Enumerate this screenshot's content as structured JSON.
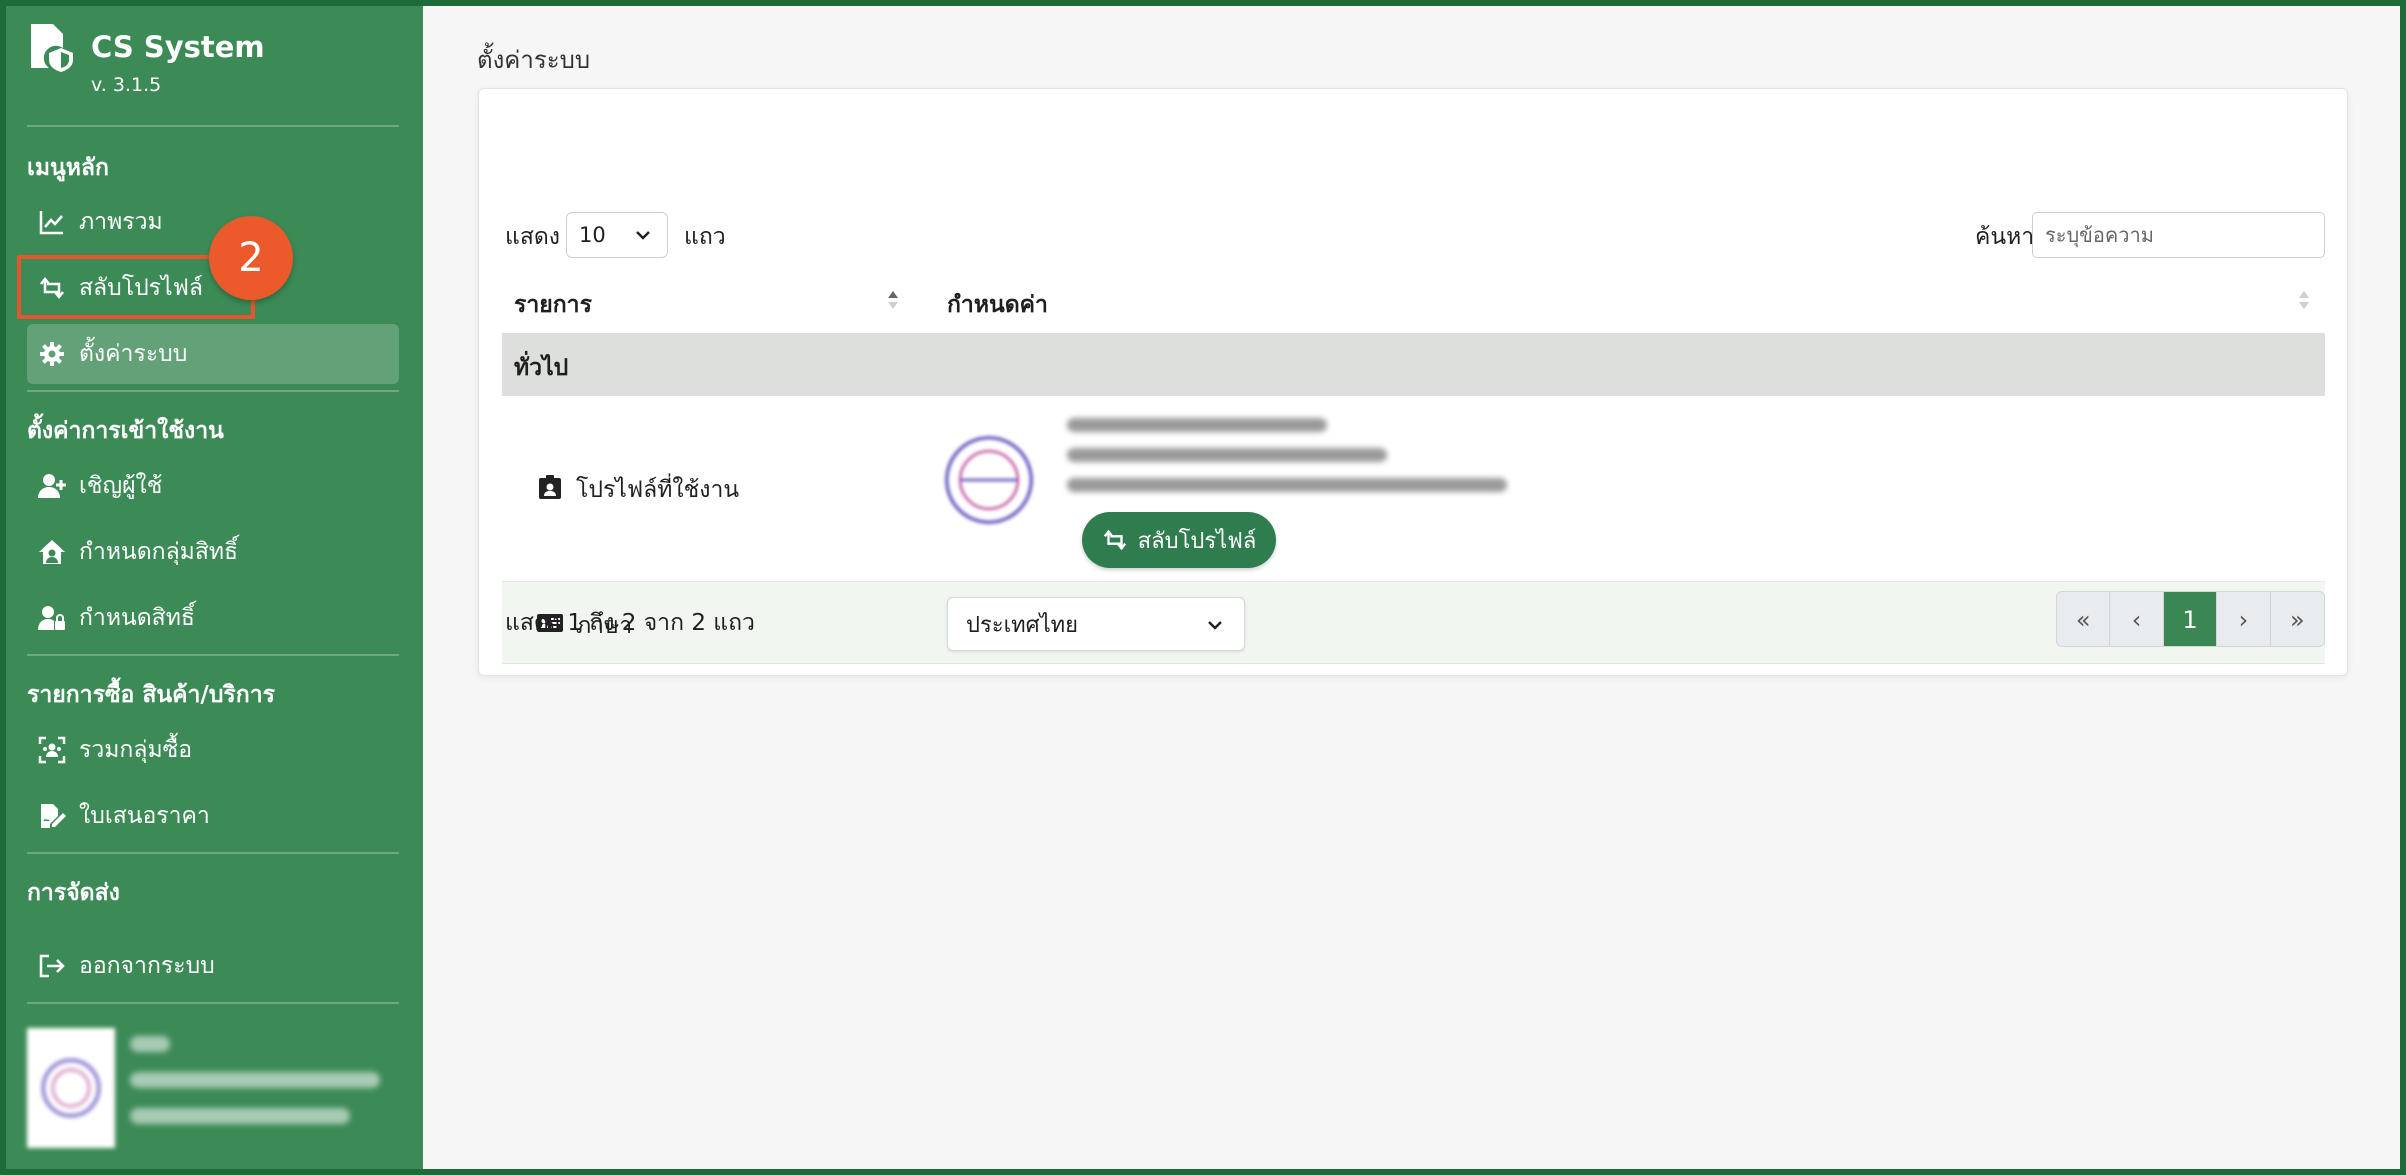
{
  "app": {
    "title": "CS System",
    "version": "v. 3.1.5"
  },
  "sidebar": {
    "sections": [
      {
        "title": "เมนูหลัก"
      },
      {
        "title": "ตั้งค่าการเข้าใช้งาน"
      },
      {
        "title": "รายการซื้อ สินค้า/บริการ"
      },
      {
        "title": "การจัดส่ง"
      }
    ],
    "items": [
      {
        "label": "ภาพรวม",
        "icon": "chart-line-icon"
      },
      {
        "label": "สลับโปรไฟล์",
        "icon": "swap-icon"
      },
      {
        "label": "ตั้งค่าระบบ",
        "icon": "gear-icon"
      },
      {
        "label": "เชิญผู้ใช้",
        "icon": "user-plus-icon"
      },
      {
        "label": "กำหนดกลุ่มสิทธิ์",
        "icon": "house-user-icon"
      },
      {
        "label": "กำหนดสิทธิ์",
        "icon": "user-lock-icon"
      },
      {
        "label": "รวมกลุ่มซื้อ",
        "icon": "group-icon"
      },
      {
        "label": "ใบเสนอราคา",
        "icon": "file-signature-icon"
      },
      {
        "label": "ออกจากระบบ",
        "icon": "logout-icon"
      }
    ],
    "active_index": 2,
    "step_badge": "2"
  },
  "main": {
    "page_title": "ตั้งค่าระบบ",
    "table": {
      "length_prefix": "แสดง",
      "length_value": "10",
      "length_suffix": "แถว",
      "search_label": "ค้นหา:",
      "search_placeholder": "ระบุข้อความ",
      "columns": [
        "รายการ",
        "กำหนดค่า"
      ],
      "group_label": "ทั่วไป",
      "rows": [
        {
          "label": "โปรไฟล์ที่ใช้งาน",
          "icon": "id-badge-icon",
          "action_label": "สลับโปรไฟล์"
        },
        {
          "label": "ภาษา",
          "icon": "id-card-icon",
          "value": "ประเทศไทย"
        }
      ],
      "info": "แสดง 1 ถึง 2 จาก 2 แถว",
      "pagination": [
        "«",
        "‹",
        "1",
        "›",
        "»"
      ],
      "current_page": "1"
    }
  },
  "colors": {
    "sidebar_bg": "#3c8b57",
    "accent": "#2f7d4e",
    "badge": "#ea5a2b",
    "group_row": "#dcdfdb"
  }
}
